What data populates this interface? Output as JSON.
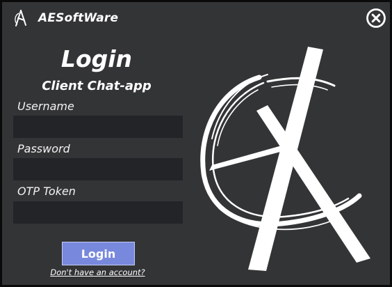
{
  "header": {
    "brand_name": "AESoftWare",
    "logo_icon": "ae-logo-icon",
    "close_icon": "close-circle-icon"
  },
  "form": {
    "title": "Login",
    "subtitle": "Client Chat-app",
    "username_label": "Username",
    "username_value": "",
    "password_label": "Password",
    "password_value": "",
    "otp_label": "OTP Token",
    "otp_value": "",
    "login_button_label": "Login",
    "signup_link_label": "Don't have an account?"
  },
  "colors": {
    "window_background": "#333436",
    "input_background": "#222428",
    "button_background": "#7889dd",
    "text": "#ffffff"
  }
}
